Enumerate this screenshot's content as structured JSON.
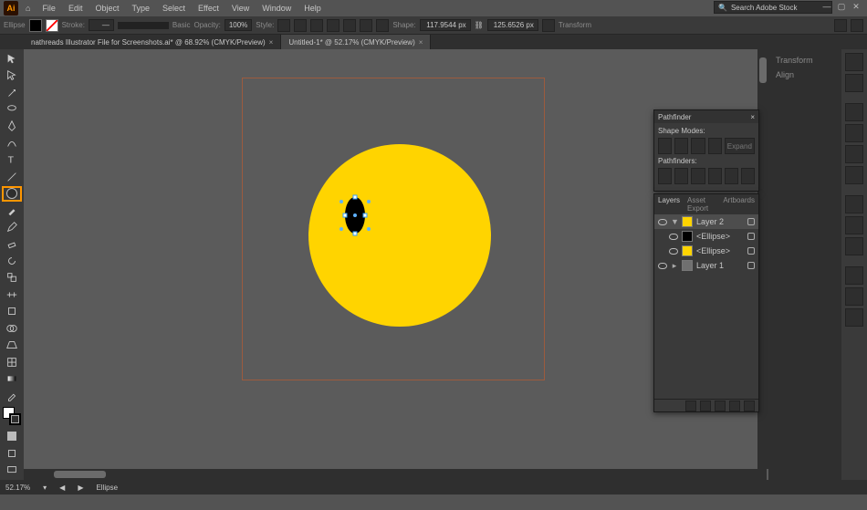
{
  "app": {
    "logo_letters": "Ai"
  },
  "menu": [
    "File",
    "Edit",
    "Object",
    "Type",
    "Select",
    "Effect",
    "View",
    "Window",
    "Help"
  ],
  "search": {
    "placeholder": "Search Adobe Stock"
  },
  "window_controls": {
    "min": "—",
    "max": "▢",
    "close": "✕"
  },
  "control_bar": {
    "context": "Ellipse",
    "fill_icon": "fill-swatch",
    "stroke_label": "Stroke:",
    "stroke_pt": "—",
    "style_label": "Basic",
    "opacity_label": "Opacity:",
    "opacity_value": "100%",
    "style_word": "Style:",
    "shape_label": "Shape:",
    "width_value": "117.9544 px",
    "height_value": "125.6526 px",
    "transform_label": "Transform"
  },
  "tabs": [
    {
      "label": "nathreads Illustrator File for Screenshots.ai* @ 68.92% (CMYK/Preview)",
      "active": false
    },
    {
      "label": "Untitled-1* @ 52.17% (CMYK/Preview)",
      "active": true
    }
  ],
  "tools": [
    {
      "name": "selection-tool"
    },
    {
      "name": "direct-selection-tool"
    },
    {
      "name": "magic-wand-tool"
    },
    {
      "name": "lasso-tool"
    },
    {
      "name": "pen-tool"
    },
    {
      "name": "curvature-tool"
    },
    {
      "name": "type-tool"
    },
    {
      "name": "line-segment-tool"
    },
    {
      "name": "ellipse-tool",
      "selected": true
    },
    {
      "name": "paintbrush-tool"
    },
    {
      "name": "pencil-tool"
    },
    {
      "name": "eraser-tool"
    },
    {
      "name": "rotate-tool"
    },
    {
      "name": "scale-tool"
    },
    {
      "name": "width-tool"
    },
    {
      "name": "free-transform-tool"
    },
    {
      "name": "shape-builder-tool"
    },
    {
      "name": "perspective-grid-tool"
    },
    {
      "name": "mesh-tool"
    },
    {
      "name": "gradient-tool"
    },
    {
      "name": "eyedropper-tool"
    },
    {
      "name": "blend-tool"
    },
    {
      "name": "symbol-sprayer-tool"
    },
    {
      "name": "column-graph-tool"
    },
    {
      "name": "artboard-tool"
    },
    {
      "name": "slice-tool"
    },
    {
      "name": "hand-tool"
    },
    {
      "name": "zoom-tool"
    }
  ],
  "status": {
    "zoom": "52.17%",
    "tool": "Ellipse"
  },
  "right_panel": {
    "tabs": [
      "Transform",
      "Align"
    ]
  },
  "pathfinder": {
    "title": "Pathfinder",
    "section1": "Shape Modes:",
    "section2": "Pathfinders:",
    "expand_label": "Expand"
  },
  "layers_panel": {
    "tabs": [
      "Layers",
      "Asset Export",
      "Artboards"
    ],
    "rows": [
      {
        "name": "Layer 2",
        "swatch": "y",
        "expanded": true,
        "selected": true,
        "indent": 0
      },
      {
        "name": "<Ellipse>",
        "swatch": "k",
        "indent": 1,
        "sub": true
      },
      {
        "name": "<Ellipse>",
        "swatch": "y",
        "indent": 1,
        "sub": true
      },
      {
        "name": "Layer 1",
        "swatch": "g",
        "indent": 0
      }
    ]
  },
  "colors": {
    "big_circle": "#ffd400",
    "eye": "#000000"
  }
}
